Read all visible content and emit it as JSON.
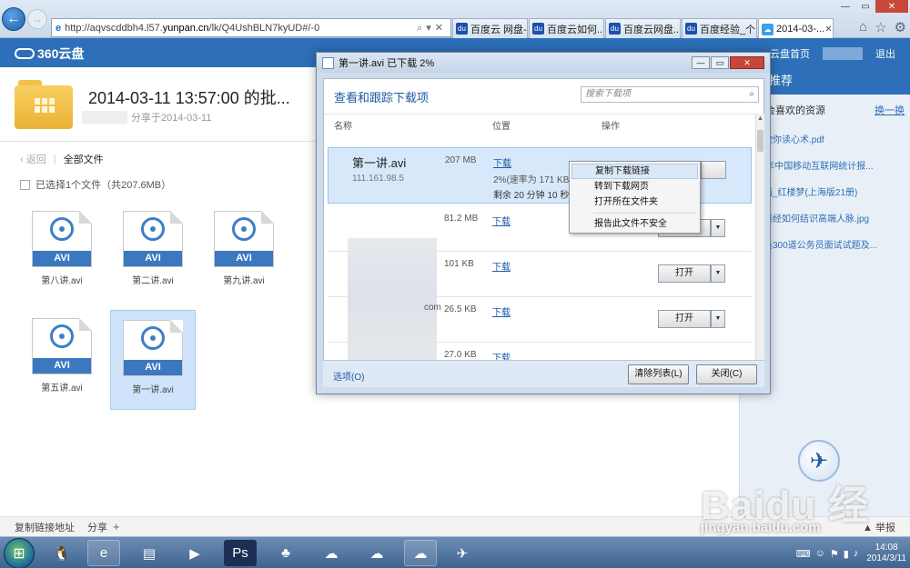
{
  "browser": {
    "address_url_prefix": "http://aqvscddbh4.l57.",
    "address_url_host": "yunpan.cn",
    "address_url_rest": "/lk/Q4UshBLN7kyUD#/-0",
    "tabs": [
      {
        "label": "百度云 网盘-..."
      },
      {
        "label": "百度云如何..."
      },
      {
        "label": "百度云网盘..."
      },
      {
        "label": "百度经验_个..."
      },
      {
        "label": "2014-03-..."
      }
    ]
  },
  "header": {
    "logo_text": "360云盘",
    "cloud_home": "云盘首页",
    "logout": "退出"
  },
  "page": {
    "title": "2014-03-11 13:57:00 的批...",
    "shared_on": "分享于2014-03-11",
    "back": "返回",
    "all_files": "全部文件",
    "selection_info": "已选择1个文件（共207.6MB）"
  },
  "files": [
    {
      "badge": "AVI",
      "name": "第八讲.avi"
    },
    {
      "badge": "AVI",
      "name": "第二讲.avi"
    },
    {
      "badge": "AVI",
      "name": "第九讲.avi"
    },
    {
      "badge": "AVI",
      "name": "第五讲.avi"
    },
    {
      "badge": "AVI",
      "name": "第一讲.avi"
    }
  ],
  "right_panel": {
    "heading": "热门推荐",
    "subheading": "可能会喜欢的资源",
    "switch_batch": "换一换",
    "items": [
      "哈佛教你读心术.pdf",
      "2013年中国移动互联网统计报...",
      "连环画_红楼梦(上海版21册)",
      "职场晨经如何结识高端人脉.jpg",
      "公务员300道公务员面试试题及..."
    ]
  },
  "bottom_bar": {
    "copy_link": "复制链接地址",
    "share": "分享",
    "plus": "+",
    "report": "举报"
  },
  "dialog": {
    "title": "第一讲.avi 已下载 2%",
    "heading": "查看和跟踪下载项",
    "search_placeholder": "搜索下载项",
    "col_name": "名称",
    "col_location": "位置",
    "col_action": "操作",
    "rows": [
      {
        "name": "第一讲.avi",
        "host": "111.161.98.5",
        "size": "207 MB",
        "location": "下载",
        "status": "2%(速率为 171 KB/秒)",
        "remaining": "剩余 20 分钟 10 秒"
      },
      {
        "size": "81.2 MB",
        "location": "下载",
        "button": "打开"
      },
      {
        "size": "101 KB",
        "location": "下载",
        "button": "打开",
        "host_suffix": "com"
      },
      {
        "size": "26.5 KB",
        "location": "下载",
        "button": "打开"
      },
      {
        "size": "27.0 KB",
        "location": "下载"
      }
    ],
    "options": "选项(O)",
    "clear_list": "清除列表(L)",
    "close": "关闭(C)"
  },
  "context_menu": {
    "items": [
      "复制下载链接",
      "转到下载网页",
      "打开所在文件夹",
      "报告此文件不安全"
    ]
  },
  "watermark": {
    "text": "Baidu 经验",
    "url": "jingyan.baidu.com"
  },
  "taskbar": {
    "time": "14:08",
    "date": "2014/3/11"
  }
}
